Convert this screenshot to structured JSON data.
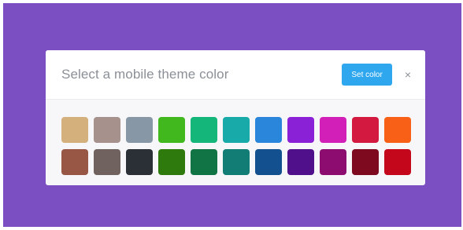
{
  "dialog": {
    "title": "Select a mobile theme color",
    "set_color_label": "Set color",
    "close_label": "×"
  },
  "colors": {
    "background": "#7b4ec2",
    "accent": "#2ea7ef"
  },
  "swatches": [
    [
      "#d3b07c",
      "#a7918c",
      "#8797a6",
      "#42b81f",
      "#14b67a",
      "#17aaa8",
      "#2a86db",
      "#8a21d6",
      "#d11fb8",
      "#d3193f",
      "#f76016"
    ],
    [
      "#985745",
      "#6f625f",
      "#2b3036",
      "#2f7a0d",
      "#117444",
      "#117d74",
      "#13508f",
      "#50108c",
      "#8d0c6f",
      "#7d0a1e",
      "#c4071a"
    ]
  ]
}
